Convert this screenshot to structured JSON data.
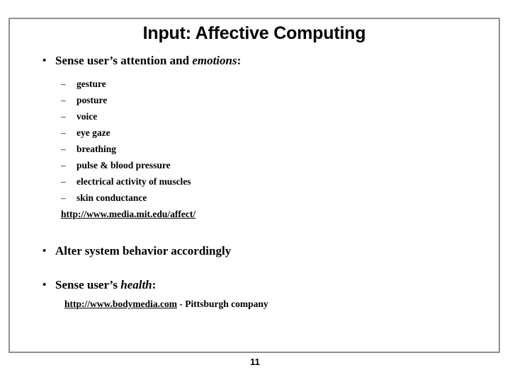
{
  "slide": {
    "title": "Input: Affective Computing",
    "page_number": "11",
    "frame_color": "#909090",
    "text_color": "#000000",
    "background_color": "#ffffff"
  },
  "bullets": {
    "b1": {
      "prefix": "Sense user’s attention and ",
      "emphasis": "emotions",
      "suffix": ":"
    },
    "b2": {
      "text": "Alter system behavior accordingly"
    },
    "b3": {
      "prefix": "Sense user’s ",
      "emphasis": "health",
      "suffix": ":"
    }
  },
  "sub_bullets": [
    {
      "marker": "–",
      "label": "gesture"
    },
    {
      "marker": "–",
      "label": "posture"
    },
    {
      "marker": "–",
      "label": "voice"
    },
    {
      "marker": "–",
      "label": "eye gaze"
    },
    {
      "marker": "–",
      "label": "breathing"
    },
    {
      "marker": "–",
      "label": "pulse & blood pressure"
    },
    {
      "marker": "–",
      "label": "electrical activity of muscles"
    },
    {
      "marker": "–",
      "label": "skin conductance"
    }
  ],
  "links": {
    "affect": {
      "text": "http://www.media.mit.edu/affect/",
      "suffix": ""
    },
    "bodymedia": {
      "text": "http://www.bodymedia.com",
      "suffix": " - Pittsburgh company"
    }
  },
  "markers": {
    "level1": "•"
  }
}
